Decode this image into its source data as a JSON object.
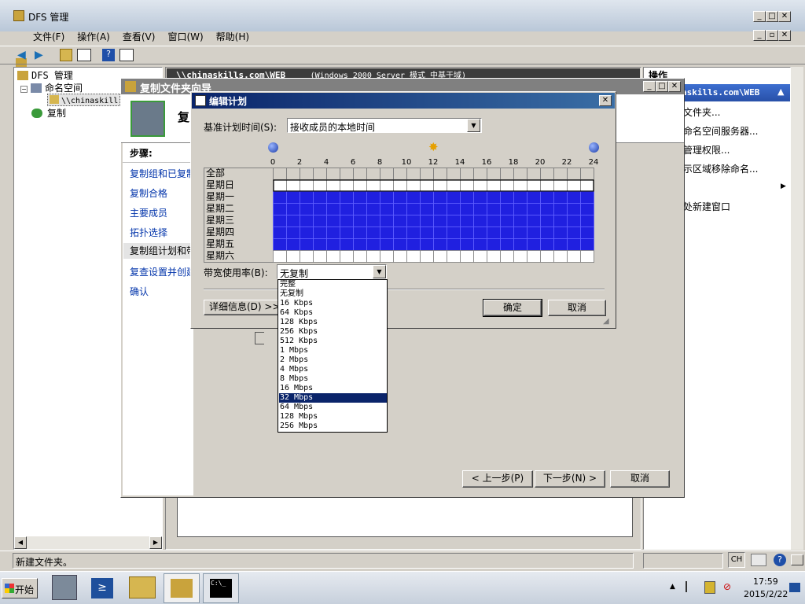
{
  "main_window": {
    "title": "DFS 管理",
    "menu": [
      "文件(F)",
      "操作(A)",
      "查看(V)",
      "窗口(W)",
      "帮助(H)"
    ]
  },
  "tree": {
    "root": "DFS 管理",
    "namespace": "命名空间",
    "ns_item": "\\\\chinaskill",
    "replication": "复制"
  },
  "content_header": {
    "path": "\\\\chinaskills.com\\WEB",
    "mode": "(Windows 2000 Server 模式 中基于域)"
  },
  "actions_panel": {
    "title": "操作",
    "section": "askills.com\\WEB",
    "items": [
      "文件夹...",
      "命名空间服务器...",
      "管理权限...",
      "示区域移除命名...",
      "",
      "处新建窗口",
      "",
      "",
      "",
      ""
    ]
  },
  "wizard": {
    "title": "复制文件夹向导",
    "header_letter": "复",
    "steps_title": "步骤:",
    "steps": [
      "复制组和已复制",
      "复制合格",
      "主要成员",
      "拓扑选择",
      "复制组计划和带",
      "复查设置并创建",
      "确认"
    ],
    "prev_button": "< 上一步(P)",
    "next_button": "下一步(N) >",
    "cancel_button": "取消"
  },
  "schedule_dialog": {
    "title": "编辑计划",
    "base_time_label": "基准计划时间(S):",
    "base_time_value": "接收成员的本地时间",
    "hour_ticks": [
      "0",
      "2",
      "4",
      "6",
      "8",
      "10",
      "12",
      "14",
      "16",
      "18",
      "20",
      "22",
      "24"
    ],
    "all_label": "全部",
    "bandwidth_label": "带宽使用率(B):",
    "bandwidth_value": "无复制",
    "details_button": "详细信息(D) >>",
    "ok_button": "确定",
    "cancel_button": "取消"
  },
  "chart_data": {
    "type": "heatmap",
    "rows": [
      "星期日",
      "星期一",
      "星期二",
      "星期三",
      "星期四",
      "星期五",
      "星期六"
    ],
    "x": [
      0,
      1,
      2,
      3,
      4,
      5,
      6,
      7,
      8,
      9,
      10,
      11,
      12,
      13,
      14,
      15,
      16,
      17,
      18,
      19,
      20,
      21,
      22,
      23
    ],
    "values": [
      [
        0,
        0,
        0,
        0,
        0,
        0,
        0,
        0,
        0,
        0,
        0,
        0,
        0,
        0,
        0,
        0,
        0,
        0,
        0,
        0,
        0,
        0,
        0,
        0
      ],
      [
        1,
        1,
        1,
        1,
        1,
        1,
        1,
        1,
        1,
        1,
        1,
        1,
        1,
        1,
        1,
        1,
        1,
        1,
        1,
        1,
        1,
        1,
        1,
        1
      ],
      [
        1,
        1,
        1,
        1,
        1,
        1,
        1,
        1,
        1,
        1,
        1,
        1,
        1,
        1,
        1,
        1,
        1,
        1,
        1,
        1,
        1,
        1,
        1,
        1
      ],
      [
        1,
        1,
        1,
        1,
        1,
        1,
        1,
        1,
        1,
        1,
        1,
        1,
        1,
        1,
        1,
        1,
        1,
        1,
        1,
        1,
        1,
        1,
        1,
        1
      ],
      [
        1,
        1,
        1,
        1,
        1,
        1,
        1,
        1,
        1,
        1,
        1,
        1,
        1,
        1,
        1,
        1,
        1,
        1,
        1,
        1,
        1,
        1,
        1,
        1
      ],
      [
        1,
        1,
        1,
        1,
        1,
        1,
        1,
        1,
        1,
        1,
        1,
        1,
        1,
        1,
        1,
        1,
        1,
        1,
        1,
        1,
        1,
        1,
        1,
        1
      ],
      [
        0,
        0,
        0,
        0,
        0,
        0,
        0,
        0,
        0,
        0,
        0,
        0,
        0,
        0,
        0,
        0,
        0,
        0,
        0,
        0,
        0,
        0,
        0,
        0
      ]
    ],
    "colors": {
      "on": "#2020e0",
      "off": "#ffffff"
    }
  },
  "bandwidth_options": [
    "完整",
    "无复制",
    "16 Kbps",
    "64 Kbps",
    "128 Kbps",
    "256 Kbps",
    "512 Kbps",
    "1 Mbps",
    "2 Mbps",
    "4 Mbps",
    "8 Mbps",
    "16 Mbps",
    "32 Mbps",
    "64 Mbps",
    "128 Mbps",
    "256 Mbps"
  ],
  "bandwidth_highlighted": "32 Mbps",
  "status_bar": {
    "text": "新建文件夹。"
  },
  "taskbar": {
    "start": "开始",
    "lang": "CH",
    "time": "17:59",
    "date": "2015/2/22"
  }
}
